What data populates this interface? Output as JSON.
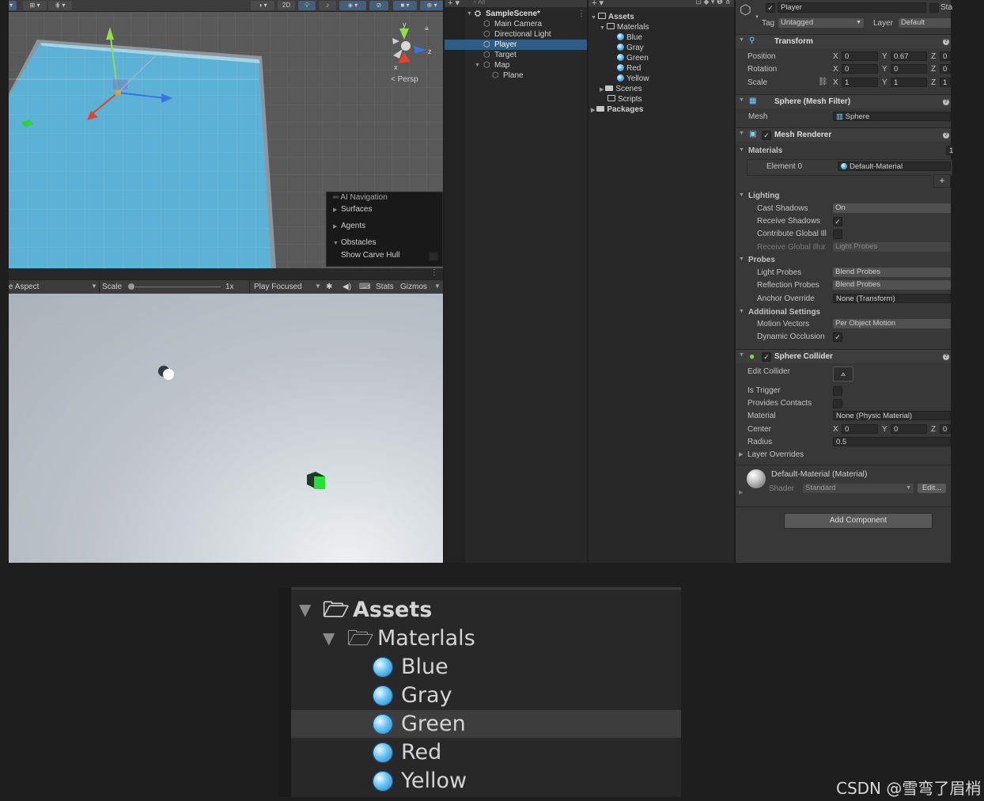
{
  "scene": {
    "toolbar": {
      "mode_2d": "2D"
    },
    "gizmo": {
      "y": "y",
      "z": "z",
      "x": "x",
      "persp": "< Persp"
    },
    "ai_navigation": {
      "title": "AI Navigation",
      "items": [
        "Surfaces",
        "Agents",
        "Obstacles"
      ],
      "show_carve_hull": "Show Carve Hull"
    }
  },
  "game_toolbar": {
    "aspect": "e Aspect",
    "scale_label": "Scale",
    "scale_value": "1x",
    "play_focused": "Play Focused",
    "stats": "Stats",
    "gizmos": "Gizmos"
  },
  "hierarchy": {
    "scene_name": "SampleScene*",
    "items": [
      {
        "label": "Main Camera",
        "selected": false
      },
      {
        "label": "Directional Light",
        "selected": false
      },
      {
        "label": "Player",
        "selected": true
      },
      {
        "label": "Target",
        "selected": false
      },
      {
        "label": "Map",
        "selected": false
      },
      {
        "label": "Plane",
        "selected": false
      }
    ]
  },
  "project": {
    "assets": "Assets",
    "materials_folder": "Materlals",
    "materials": [
      "Blue",
      "Gray",
      "Green",
      "Red",
      "Yellow"
    ],
    "scenes": "Scenes",
    "scripts": "Scripts",
    "packages": "Packages"
  },
  "inspector": {
    "object_name": "Player",
    "static_label": "Sta",
    "tag_label": "Tag",
    "tag_value": "Untagged",
    "layer_label": "Layer",
    "layer_value": "Default",
    "transform": {
      "title": "Transform",
      "position_label": "Position",
      "position": {
        "x": "0",
        "y": "0.67",
        "z": "0"
      },
      "rotation_label": "Rotation",
      "rotation": {
        "x": "0",
        "y": "0",
        "z": "0"
      },
      "scale_label": "Scale",
      "scale": {
        "x": "1",
        "y": "1",
        "z": "1"
      }
    },
    "mesh_filter": {
      "title": "Sphere (Mesh Filter)",
      "mesh_label": "Mesh",
      "mesh_value": "Sphere"
    },
    "mesh_renderer": {
      "title": "Mesh Renderer",
      "materials_label": "Materials",
      "materials_count": "1",
      "element0_label": "Element 0",
      "element0_value": "Default-Material",
      "plus": "+",
      "lighting": "Lighting",
      "cast_shadows_label": "Cast Shadows",
      "cast_shadows_value": "On",
      "receive_shadows_label": "Receive Shadows",
      "contribute_gi_label": "Contribute Global Ill",
      "receive_gi_label": "Receive Global Illur",
      "receive_gi_value": "Light Probes",
      "probes": "Probes",
      "light_probes_label": "Light Probes",
      "light_probes_value": "Blend Probes",
      "reflection_probes_label": "Reflection Probes",
      "reflection_probes_value": "Blend Probes",
      "anchor_override_label": "Anchor Override",
      "anchor_override_value": "None (Transform)",
      "additional_settings": "Additional Settings",
      "motion_vectors_label": "Motion Vectors",
      "motion_vectors_value": "Per Object Motion",
      "dynamic_occlusion_label": "Dynamic Occlusion"
    },
    "sphere_collider": {
      "title": "Sphere Collider",
      "edit_collider_label": "Edit Collider",
      "is_trigger_label": "Is Trigger",
      "provides_contacts_label": "Provides Contacts",
      "material_label": "Material",
      "material_value": "None (Physic Material)",
      "center_label": "Center",
      "center": {
        "x": "0",
        "y": "0",
        "z": "0"
      },
      "radius_label": "Radius",
      "radius_value": "0.5",
      "layer_overrides": "Layer Overrides"
    },
    "material_preview": {
      "title": "Default-Material (Material)",
      "shader_label": "Shader",
      "shader_value": "Standard",
      "edit": "Edit..."
    },
    "add_component": "Add Component",
    "axis": {
      "x": "X",
      "y": "Y",
      "z": "Z"
    },
    "check": "✓"
  },
  "zoom_panel": {
    "assets": "Assets",
    "materials_folder": "Materlals",
    "materials": [
      "Blue",
      "Gray",
      "Green",
      "Red",
      "Yellow"
    ],
    "highlighted": "Green"
  },
  "watermark": "CSDN @雪弯了眉梢",
  "colors": {
    "selection": "#2c5d87",
    "plane": "#5fb0d4",
    "material_icon": "#4aa8e6",
    "panel": "#383838"
  }
}
